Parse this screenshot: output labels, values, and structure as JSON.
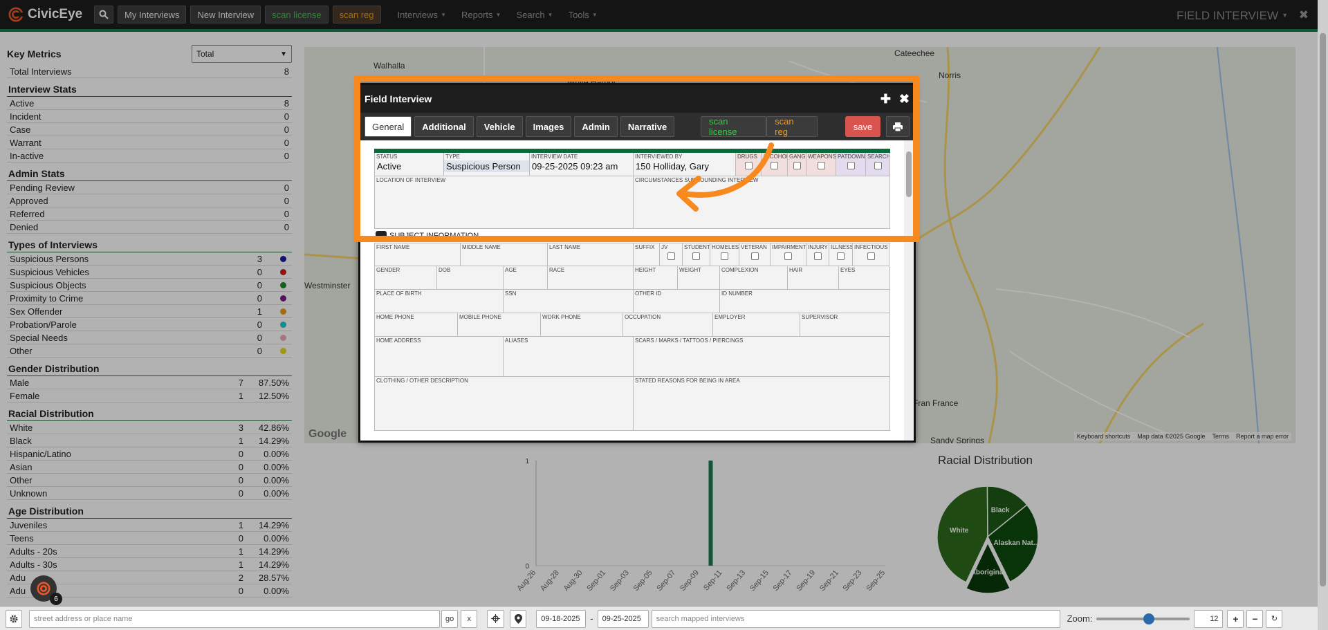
{
  "navbar": {
    "brand": "CivicEye",
    "buttons": [
      "My Interviews",
      "New Interview"
    ],
    "scan_license": "scan license",
    "scan_reg": "scan reg",
    "menus": [
      "Interviews",
      "Reports",
      "Search",
      "Tools"
    ],
    "title": "FIELD INTERVIEW"
  },
  "key_metrics": {
    "title": "Key Metrics",
    "select_value": "Total",
    "total_label": "Total Interviews",
    "total_value": "8"
  },
  "interview_stats": {
    "title": "Interview Stats",
    "rows": [
      {
        "label": "Active",
        "count": "8"
      },
      {
        "label": "Incident",
        "count": "0"
      },
      {
        "label": "Case",
        "count": "0"
      },
      {
        "label": "Warrant",
        "count": "0"
      },
      {
        "label": "In-active",
        "count": "0"
      }
    ]
  },
  "admin_stats": {
    "title": "Admin Stats",
    "rows": [
      {
        "label": "Pending Review",
        "count": "0"
      },
      {
        "label": "Approved",
        "count": "0"
      },
      {
        "label": "Referred",
        "count": "0"
      },
      {
        "label": "Denied",
        "count": "0"
      }
    ]
  },
  "types": {
    "title": "Types of Interviews",
    "rows": [
      {
        "label": "Suspicious Persons",
        "count": "3",
        "color": "#1a1aa8"
      },
      {
        "label": "Suspicious Vehicles",
        "count": "0",
        "color": "#c81e1e"
      },
      {
        "label": "Suspicious Objects",
        "count": "0",
        "color": "#1e8a2a"
      },
      {
        "label": "Proximity to Crime",
        "count": "0",
        "color": "#7a1a8a"
      },
      {
        "label": "Sex Offender",
        "count": "1",
        "color": "#f09a1a"
      },
      {
        "label": "Probation/Parole",
        "count": "0",
        "color": "#1ac8c8"
      },
      {
        "label": "Special Needs",
        "count": "0",
        "color": "#f0a8b8"
      },
      {
        "label": "Other",
        "count": "0",
        "color": "#e8d81a"
      }
    ]
  },
  "gender": {
    "title": "Gender Distribution",
    "rows": [
      {
        "label": "Male",
        "count": "7",
        "pct": "87.50%"
      },
      {
        "label": "Female",
        "count": "1",
        "pct": "12.50%"
      }
    ]
  },
  "racial": {
    "title": "Racial Distribution",
    "rows": [
      {
        "label": "White",
        "count": "3",
        "pct": "42.86%"
      },
      {
        "label": "Black",
        "count": "1",
        "pct": "14.29%"
      },
      {
        "label": "Hispanic/Latino",
        "count": "0",
        "pct": "0.00%"
      },
      {
        "label": "Asian",
        "count": "0",
        "pct": "0.00%"
      },
      {
        "label": "Other",
        "count": "0",
        "pct": "0.00%"
      },
      {
        "label": "Unknown",
        "count": "0",
        "pct": "0.00%"
      }
    ]
  },
  "age": {
    "title": "Age Distribution",
    "rows": [
      {
        "label": "Juveniles",
        "count": "1",
        "pct": "14.29%"
      },
      {
        "label": "Teens",
        "count": "0",
        "pct": "0.00%"
      },
      {
        "label": "Adults - 20s",
        "count": "1",
        "pct": "14.29%"
      },
      {
        "label": "Adults - 30s",
        "count": "1",
        "pct": "14.29%"
      },
      {
        "label": "Adu",
        "count": "2",
        "pct": "28.57%"
      },
      {
        "label": "Adu",
        "count": "0",
        "pct": "0.00%"
      }
    ]
  },
  "map": {
    "places": [
      "Walhalla",
      "White Harbor",
      "Cateechee",
      "Norris",
      "Westminster",
      "Sandy Springs",
      "Fran France"
    ],
    "footer": [
      "Keyboard shortcuts",
      "Map data ©2025 Google",
      "Terms",
      "Report a map error"
    ],
    "google": "Google"
  },
  "modal": {
    "title": "Field Interview",
    "tabs": [
      "General",
      "Additional",
      "Vehicle",
      "Images",
      "Admin",
      "Narrative"
    ],
    "scan_license": "scan license",
    "scan_reg": "scan reg",
    "save": "save",
    "labels": {
      "status": "STATUS",
      "type": "TYPE",
      "interview_date": "INTERVIEW DATE",
      "interviewed_by": "INTERVIEWED BY",
      "drugs": "DRUGS",
      "alcohol": "ALCOHOL",
      "gang": "GANG",
      "weapons": "WEAPONS",
      "patdown": "PATDOWN",
      "search": "SEARCH",
      "location": "LOCATION OF INTERVIEW",
      "circumstances": "CIRCUMSTANCES SURROUNDING INTERVIEW",
      "subject_info": "SUBJECT INFORMATION",
      "first_name": "FIRST NAME",
      "middle_name": "MIDDLE NAME",
      "last_name": "LAST NAME",
      "suffix": "SUFFIX",
      "jv": "JV",
      "student": "STUDENT",
      "homeless": "HOMELESS",
      "veteran": "VETERAN",
      "impairment": "IMPAIRMENT",
      "injury": "INJURY",
      "illness": "ILLNESS",
      "infectious": "INFECTIOUS",
      "gender": "GENDER",
      "dob": "DOB",
      "age": "AGE",
      "race": "RACE",
      "height": "HEIGHT",
      "weight": "WEIGHT",
      "complexion": "COMPLEXION",
      "hair": "HAIR",
      "eyes": "EYES",
      "place_of_birth": "PLACE OF BIRTH",
      "ssn": "SSN",
      "other_id": "OTHER ID",
      "id_number": "ID NUMBER",
      "home_phone": "HOME PHONE",
      "mobile_phone": "MOBILE PHONE",
      "work_phone": "WORK PHONE",
      "occupation": "OCCUPATION",
      "employer": "EMPLOYER",
      "supervisor": "SUPERVISOR",
      "home_address": "HOME ADDRESS",
      "aliases": "ALIASES",
      "scars": "SCARS / MARKS / TATTOOS / PIERCINGS",
      "clothing": "CLOTHING / OTHER DESCRIPTION",
      "stated_reasons": "STATED REASONS FOR BEING IN AREA"
    },
    "values": {
      "status": "Active",
      "type": "Suspicious Person",
      "interview_date": "09-25-2025 09:23 am",
      "interviewed_by": "150 Holliday, Gary"
    }
  },
  "bar_chart": {
    "y_ticks": [
      "1",
      "0"
    ],
    "x_ticks": [
      "Aug-26",
      "Aug-28",
      "Aug-30",
      "Sep-01",
      "Sep-03",
      "Sep-05",
      "Sep-07",
      "Sep-09",
      "Sep-11",
      "Sep-13",
      "Sep-15",
      "Sep-17",
      "Sep-19",
      "Sep-21",
      "Sep-23",
      "Sep-25"
    ]
  },
  "chart_data": [
    {
      "type": "bar",
      "categories": [
        "Aug-26",
        "Aug-28",
        "Aug-30",
        "Sep-01",
        "Sep-03",
        "Sep-05",
        "Sep-07",
        "Sep-09",
        "Sep-11",
        "Sep-13",
        "Sep-15",
        "Sep-17",
        "Sep-19",
        "Sep-21",
        "Sep-23",
        "Sep-25"
      ],
      "values": [
        0,
        0,
        0,
        0,
        0,
        0,
        0,
        1,
        0,
        0,
        0,
        0,
        0,
        0,
        0,
        0
      ],
      "ylim": [
        0,
        1
      ],
      "color": "#1a7a4f"
    },
    {
      "type": "pie",
      "title": "Racial Distribution",
      "slices": [
        {
          "label": "White",
          "value": 42.86,
          "color": "#2e6a1e"
        },
        {
          "label": "Black",
          "value": 14.29,
          "color": "#1e5a18"
        },
        {
          "label": "Alaskan Nat...",
          "value": 28.57,
          "color": "#0e4a0e"
        },
        {
          "label": "Aboriginal",
          "value": 14.29,
          "color": "#0a3a0a",
          "exploded": true
        }
      ]
    }
  ],
  "bottom_bar": {
    "address_placeholder": "street address or place name",
    "go": "go",
    "clear": "x",
    "date_from": "09-18-2025",
    "date_sep": "-",
    "date_to": "09-25-2025",
    "search_placeholder": "search mapped interviews",
    "zoom_label": "Zoom:",
    "zoom_value": "12",
    "badge": "6"
  }
}
